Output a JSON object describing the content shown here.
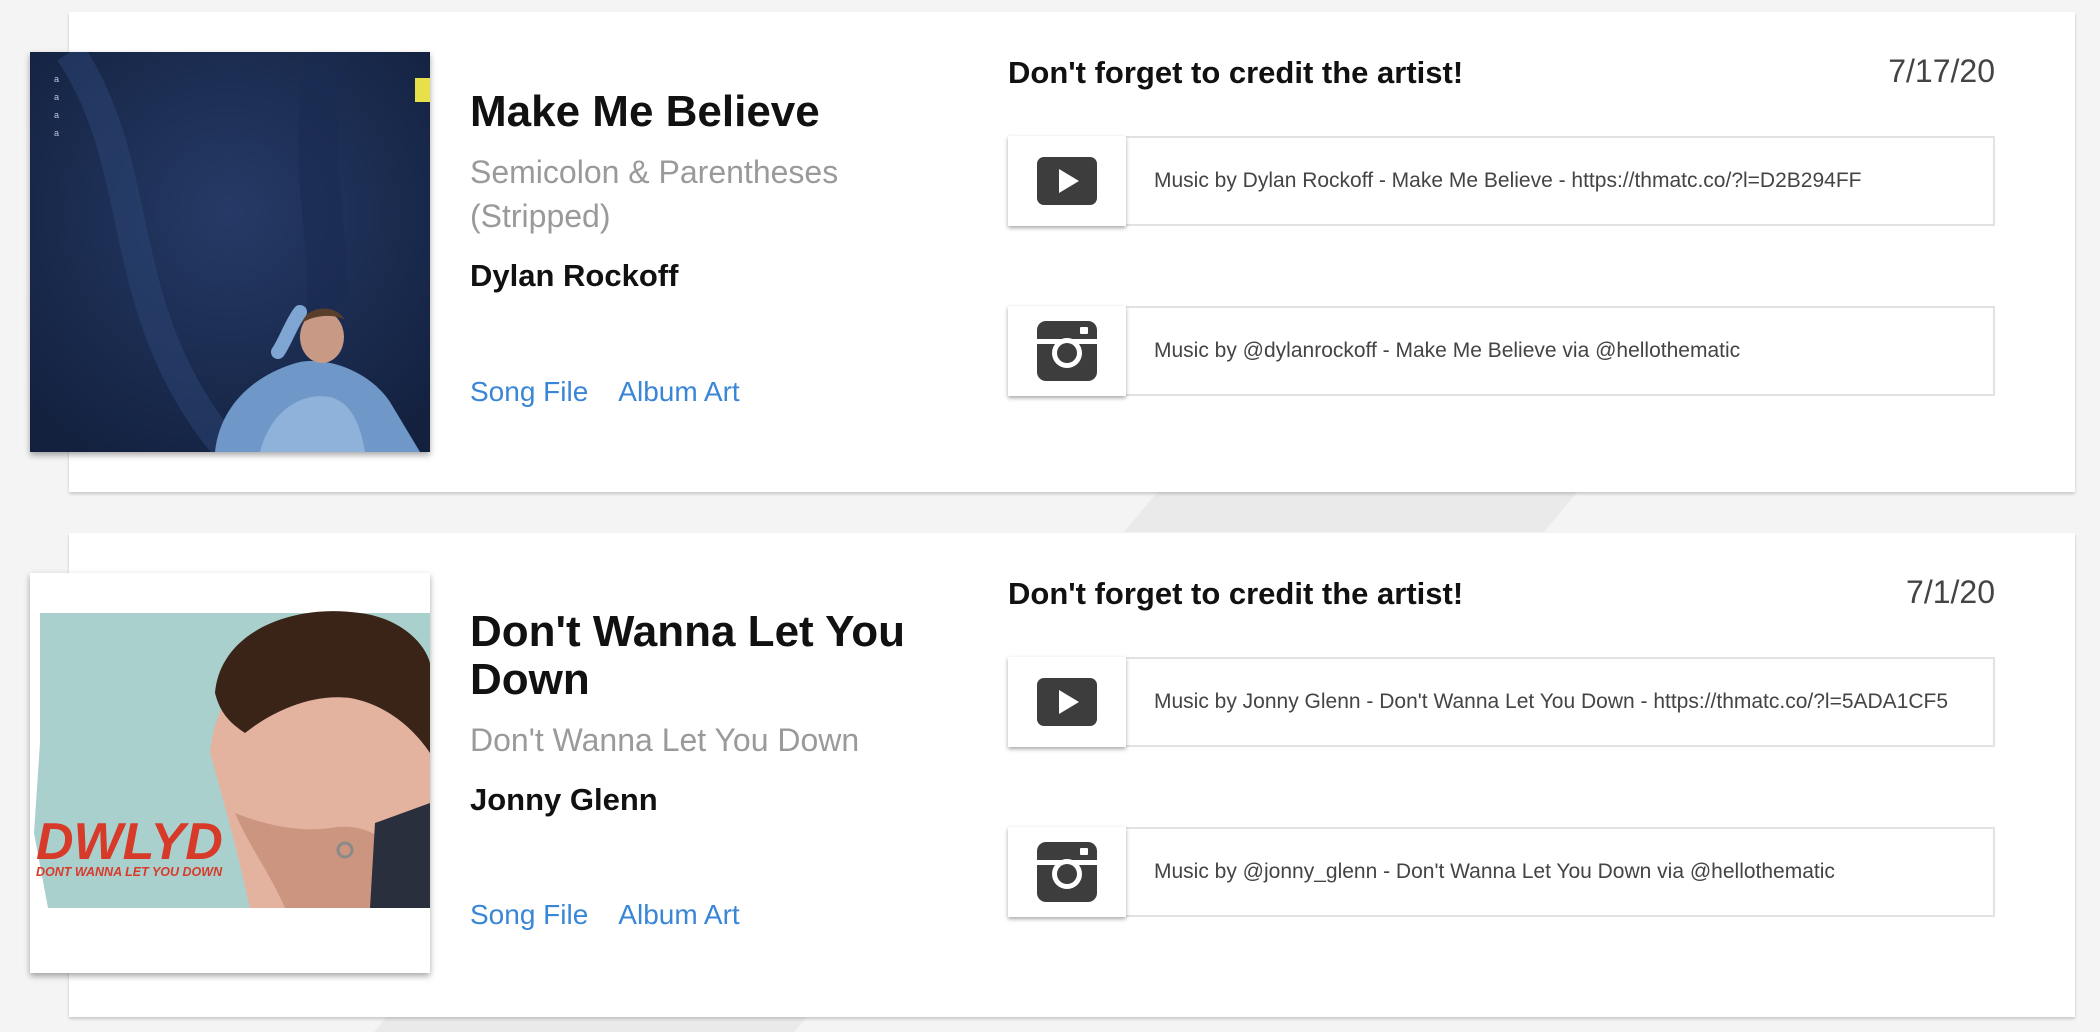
{
  "songs": [
    {
      "title": "Make Me Believe",
      "album": "Semicolon & Parentheses (Stripped)",
      "artist": "Dylan Rockoff",
      "links": {
        "song_file": "Song File",
        "album_art": "Album Art"
      },
      "credit_heading": "Don't forget to credit the artist!",
      "date": "7/17/20",
      "credits": {
        "youtube": "Music by Dylan Rockoff - Make Me Believe - https://thmatc.co/?l=D2B294FF",
        "instagram": "Music by @dylanrockoff - Make Me Believe via @hellothematic"
      },
      "art": {
        "background": "#1c2e52",
        "accent": "#e8e04a"
      }
    },
    {
      "title": "Don't Wanna Let You Down",
      "album": "Don't Wanna Let You Down",
      "artist": "Jonny Glenn",
      "links": {
        "song_file": "Song File",
        "album_art": "Album Art"
      },
      "credit_heading": "Don't forget to credit the artist!",
      "date": "7/1/20",
      "credits": {
        "youtube": "Music by Jonny Glenn - Don't Wanna Let You Down - https://thmatc.co/?l=5ADA1CF5",
        "instagram": "Music by @jonny_glenn - Don't Wanna Let You Down via @hellothematic"
      },
      "art": {
        "background": "#a9d0cd",
        "logo_text": "DWLYD",
        "logo_subtext": "DONT WANNA LET YOU DOWN",
        "logo_color": "#d83a2a"
      }
    }
  ],
  "icons": {
    "play": "youtube-play-icon",
    "instagram": "instagram-icon"
  },
  "colors": {
    "link": "#3a86d6",
    "muted": "#9a9a9a",
    "icon": "#3d3d3d"
  }
}
